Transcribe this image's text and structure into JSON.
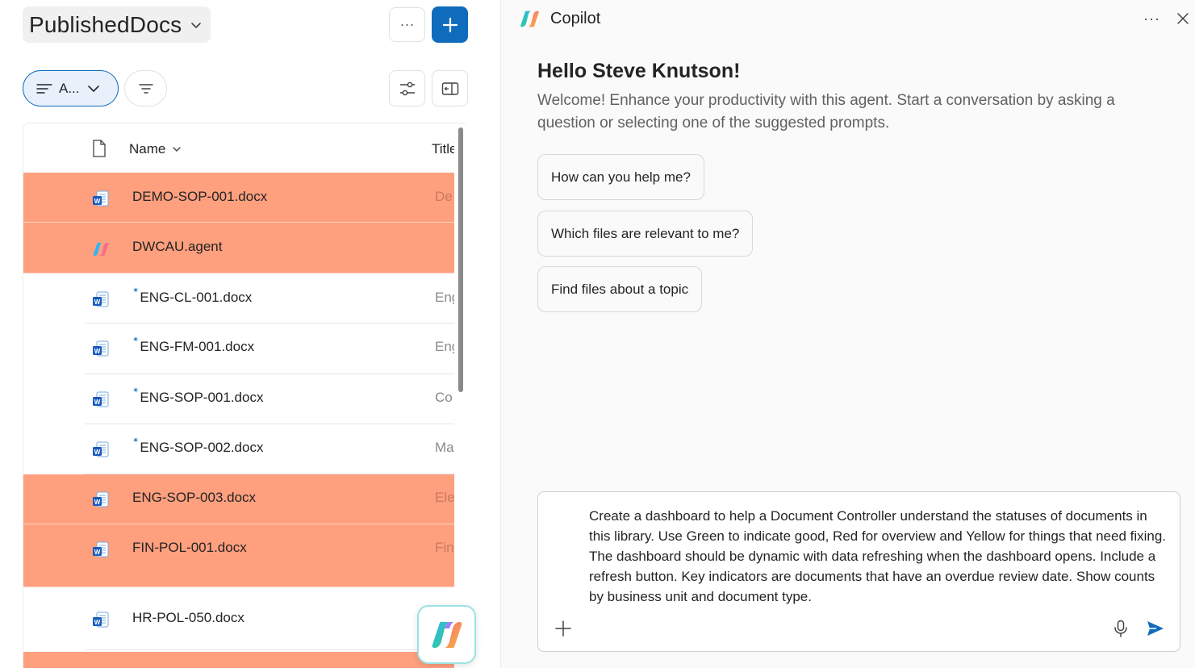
{
  "library": {
    "title": "PublishedDocs",
    "view_label": "A...",
    "more_label": "···"
  },
  "list": {
    "headers": {
      "name": "Name",
      "title": "Title"
    },
    "rows": [
      {
        "name": "DEMO-SOP-001.docx",
        "title": "De",
        "icon": "word-icon",
        "highlight": true,
        "new": false
      },
      {
        "name": "DWCAU.agent",
        "title": "",
        "icon": "copilot-agent-icon",
        "highlight": true,
        "new": false
      },
      {
        "name": "ENG-CL-001.docx",
        "title": "Eng",
        "icon": "word-icon",
        "highlight": false,
        "new": true
      },
      {
        "name": "ENG-FM-001.docx",
        "title": "Eng",
        "icon": "word-icon",
        "highlight": false,
        "new": true
      },
      {
        "name": "ENG-SOP-001.docx",
        "title": "Co",
        "icon": "word-icon",
        "highlight": false,
        "new": true
      },
      {
        "name": "ENG-SOP-002.docx",
        "title": "Ma",
        "icon": "word-icon",
        "highlight": false,
        "new": true
      },
      {
        "name": "ENG-SOP-003.docx",
        "title": "Ele",
        "icon": "word-icon",
        "highlight": true,
        "new": false
      },
      {
        "name": "FIN-POL-001.docx",
        "title": "Fin",
        "icon": "word-icon",
        "highlight": true,
        "new": false
      },
      {
        "name": "HR-POL-050.docx",
        "title": "",
        "icon": "word-icon",
        "highlight": false,
        "new": false
      }
    ]
  },
  "copilot": {
    "title": "Copilot",
    "more_label": "···",
    "greeting": "Hello Steve Knutson!",
    "welcome": "Welcome! Enhance your productivity with this agent. Start a conversation by asking a question or selecting one of the suggested prompts.",
    "prompts": [
      "How can you help me?",
      "Which files are relevant to me?",
      "Find files about a topic"
    ],
    "compose_text": "Create a dashboard to help a Document Controller understand the statuses of documents in this library. Use Green to indicate good, Red for overview and Yellow for things that need fixing. The dashboard should be dynamic with data refreshing when the dashboard opens. Include a refresh button. Key indicators are documents that have an overdue review date. Show counts by business unit and document type."
  },
  "colors": {
    "accent": "#0f6cbd",
    "row_highlight": "#fe9f7e"
  }
}
